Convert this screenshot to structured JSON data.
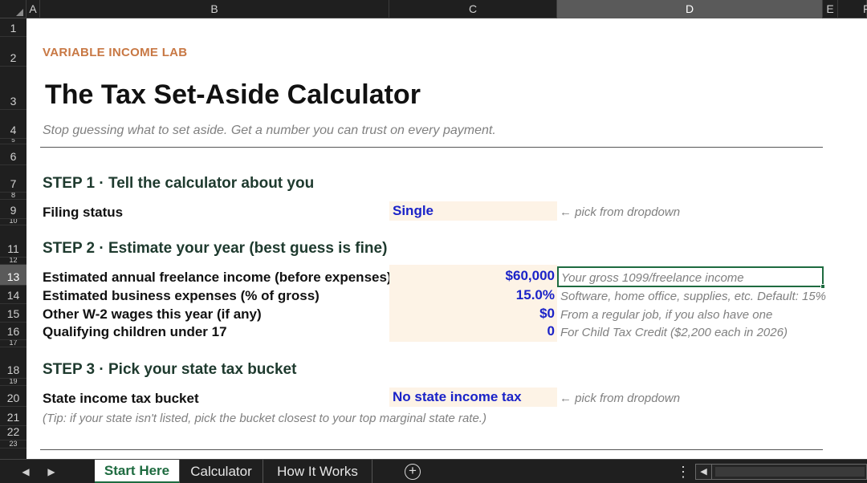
{
  "columns": {
    "a": "A",
    "b": "B",
    "c": "C",
    "d": "D",
    "e": "E",
    "f": "F"
  },
  "rows": [
    "1",
    "2",
    "3",
    "4",
    "5",
    "6",
    "7",
    "8",
    "9",
    "10",
    "11",
    "12",
    "13",
    "14",
    "15",
    "16",
    "17",
    "18",
    "19",
    "20",
    "21",
    "22",
    "23"
  ],
  "sheet": {
    "brand": "VARIABLE INCOME LAB",
    "title": "The Tax Set-Aside Calculator",
    "subtitle": "Stop guessing what to set aside. Get a number you can trust on every payment.",
    "step1": {
      "heading": "STEP 1  ·  Tell the calculator about you",
      "filing_label": "Filing status",
      "filing_value": "Single",
      "filing_hint": "← pick from dropdown"
    },
    "step2": {
      "heading": "STEP 2  ·  Estimate your year (best guess is fine)",
      "rows": [
        {
          "label": "Estimated annual freelance income (before expenses)",
          "value": "$60,000",
          "hint": "Your gross 1099/freelance income"
        },
        {
          "label": "Estimated business expenses (% of gross)",
          "value": "15.0%",
          "hint": "Software, home office, supplies, etc. Default: 15%"
        },
        {
          "label": "Other W-2 wages this year (if any)",
          "value": "$0",
          "hint": "From a regular job, if you also have one"
        },
        {
          "label": "Qualifying children under 17",
          "value": "0",
          "hint": "For Child Tax Credit ($2,200 each in 2026)"
        }
      ]
    },
    "step3": {
      "heading": "STEP 3  ·  Pick your state tax bucket",
      "state_label": "State income tax bucket",
      "state_value": "No state income tax",
      "state_hint": "← pick from dropdown",
      "tip": "(Tip: if your state isn't listed, pick the bucket closest to your top marginal state rate.)"
    }
  },
  "tabs": {
    "start": "Start Here",
    "calculator": "Calculator",
    "how": "How It Works"
  },
  "icons": {
    "prev": "◀",
    "next": "▶",
    "add": "+",
    "more": "⋮",
    "scroll_left": "◀"
  },
  "colors": {
    "brand": "#c87844",
    "input_fill": "#fdf3e6",
    "input_text": "#1a22c8",
    "accent": "#1e6b40"
  }
}
